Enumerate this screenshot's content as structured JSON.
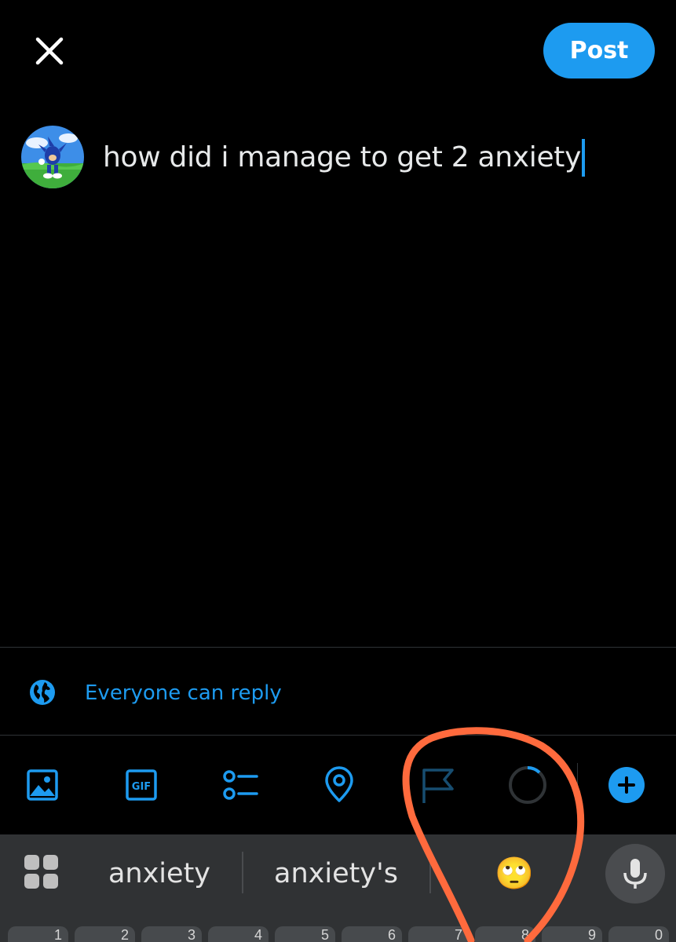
{
  "header": {
    "close_icon": "close-icon",
    "post_label": "Post"
  },
  "compose": {
    "text": "how did i manage to get 2 anxiety"
  },
  "reply_settings": {
    "icon": "globe-icon",
    "label": "Everyone can reply"
  },
  "toolbar": {
    "icons": [
      "image-icon",
      "gif-icon",
      "poll-icon",
      "location-icon",
      "flag-icon",
      "character-count-ring",
      "add-post-icon"
    ]
  },
  "keyboard": {
    "suggestions": [
      "anxiety",
      "anxiety's",
      "🙄"
    ],
    "number_keys": [
      "1",
      "2",
      "3",
      "4",
      "5",
      "6",
      "7",
      "8",
      "9",
      "0"
    ]
  },
  "colors": {
    "accent": "#1d9bf0",
    "background": "#000000",
    "annotation": "#ff6a3d"
  }
}
